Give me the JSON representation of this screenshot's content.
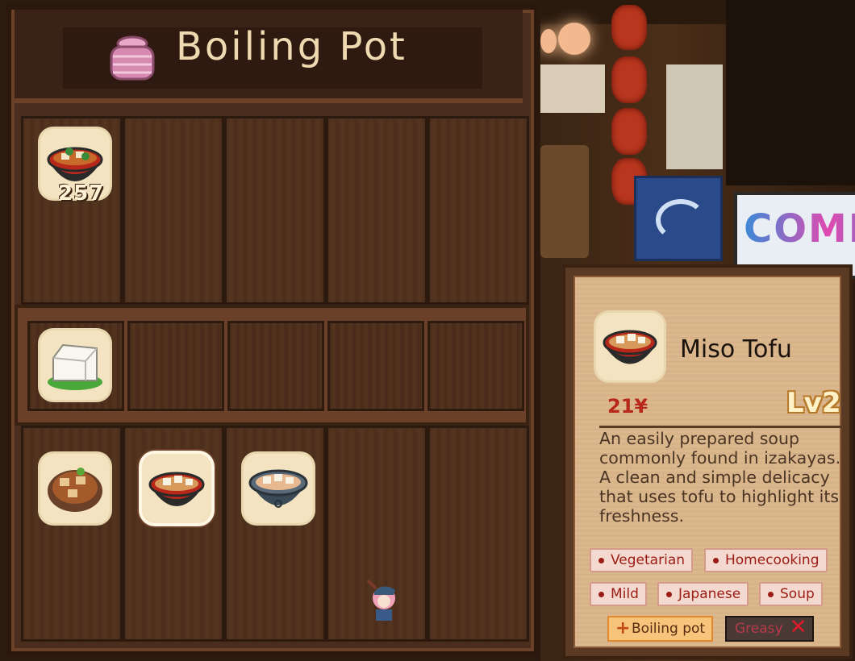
{
  "panel": {
    "title": "Boiling Pot",
    "ingredient_quantity": "257"
  },
  "inventory": {
    "ingredients_top": [
      "miso-soup-pot-icon"
    ],
    "ingredients_shelf": [
      "tofu-icon"
    ],
    "dishes": [
      "braised-tofu-icon",
      "miso-tofu-icon",
      "tofu-stew-icon"
    ],
    "selected_dish_index": 1
  },
  "tooltip": {
    "name": "Miso Tofu",
    "price": "21¥",
    "level": "Lv2",
    "description": "An easily prepared soup commonly found in izakayas. A clean and simple delicacy that uses tofu to highlight its freshness.",
    "tags": [
      "Vegetarian",
      "Homecooking",
      "Mild",
      "Japanese",
      "Soup"
    ],
    "cookware_tag": "Boiling pot",
    "negative_tag": "Greasy"
  },
  "scene": {
    "sign_text": "COMBO"
  },
  "colors": {
    "panel_wood": "#4a2d1c",
    "card_paper": "#d8b48a",
    "price_red": "#b8281a",
    "tag_red": "#9a1c14"
  }
}
